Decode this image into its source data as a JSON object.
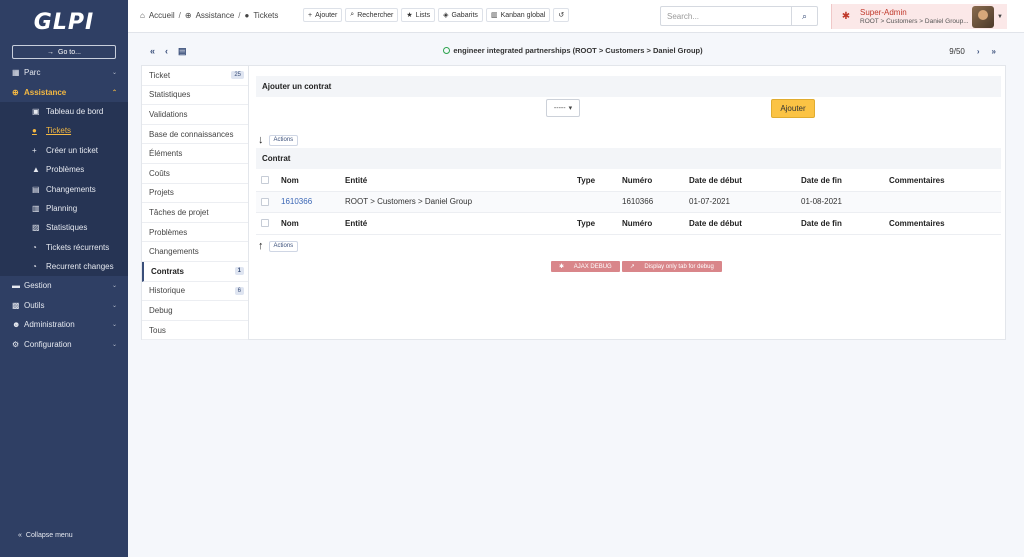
{
  "app": {
    "logo": "GLPI"
  },
  "sidebar": {
    "goto_label": "Go to...",
    "items": [
      {
        "label": "Parc",
        "icon": "cubes-icon"
      },
      {
        "label": "Assistance",
        "icon": "lifebuoy-icon",
        "active": true
      },
      {
        "label": "Gestion",
        "icon": "wallet-icon"
      },
      {
        "label": "Outils",
        "icon": "briefcase-icon"
      },
      {
        "label": "Administration",
        "icon": "users-cog-icon"
      },
      {
        "label": "Configuration",
        "icon": "cogs-icon"
      }
    ],
    "subitems": [
      {
        "label": "Tableau de bord",
        "icon": "dashboard-icon"
      },
      {
        "label": "Tickets",
        "icon": "ticket-icon",
        "current": true
      },
      {
        "label": "Créer un ticket",
        "icon": "plus-icon"
      },
      {
        "label": "Problèmes",
        "icon": "warning-icon"
      },
      {
        "label": "Changements",
        "icon": "clipboard-icon"
      },
      {
        "label": "Planning",
        "icon": "calendar-icon"
      },
      {
        "label": "Statistiques",
        "icon": "chart-icon"
      },
      {
        "label": "Tickets récurrents",
        "icon": "stopwatch-icon"
      },
      {
        "label": "Recurrent changes",
        "icon": "stopwatch-icon"
      }
    ],
    "collapse_label": "Collapse menu"
  },
  "breadcrumb": {
    "home": "Accueil",
    "assistance": "Assistance",
    "tickets": "Tickets"
  },
  "toolbar": {
    "add": "Ajouter",
    "search": "Rechercher",
    "lists": "Lists",
    "templates": "Gabarits",
    "kanban": "Kanban global"
  },
  "search": {
    "placeholder": "Search..."
  },
  "user": {
    "role": "Super-Admin",
    "entity": "ROOT > Customers > Daniel Group..."
  },
  "nav": {
    "title": "engineer integrated partnerships (ROOT > Customers > Daniel Group)",
    "position": "9/50"
  },
  "tabs": [
    {
      "label": "Ticket",
      "badge": "25"
    },
    {
      "label": "Statistiques"
    },
    {
      "label": "Validations"
    },
    {
      "label": "Base de connaissances"
    },
    {
      "label": "Éléments"
    },
    {
      "label": "Coûts"
    },
    {
      "label": "Projets"
    },
    {
      "label": "Tâches de projet"
    },
    {
      "label": "Problèmes"
    },
    {
      "label": "Changements"
    },
    {
      "label": "Contrats",
      "badge": "1",
      "active": true
    },
    {
      "label": "Historique",
      "badge": "6"
    },
    {
      "label": "Debug"
    },
    {
      "label": "Tous"
    }
  ],
  "add_contract": {
    "title": "Ajouter un contrat",
    "select_value": "-----",
    "button": "Ajouter"
  },
  "contracts": {
    "title": "Contrat",
    "actions_label": "Actions",
    "columns": [
      "Nom",
      "Entité",
      "Type",
      "Numéro",
      "Date de début",
      "Date de fin",
      "Commentaires"
    ],
    "rows": [
      {
        "name": "1610366",
        "entity": "ROOT > Customers > Daniel Group",
        "type": "",
        "number": "1610366",
        "start": "01-07-2021",
        "end": "01-08-2021",
        "comments": ""
      }
    ]
  },
  "debug": {
    "ajax": "AJAX DEBUG",
    "display": "Display only tab for debug"
  }
}
